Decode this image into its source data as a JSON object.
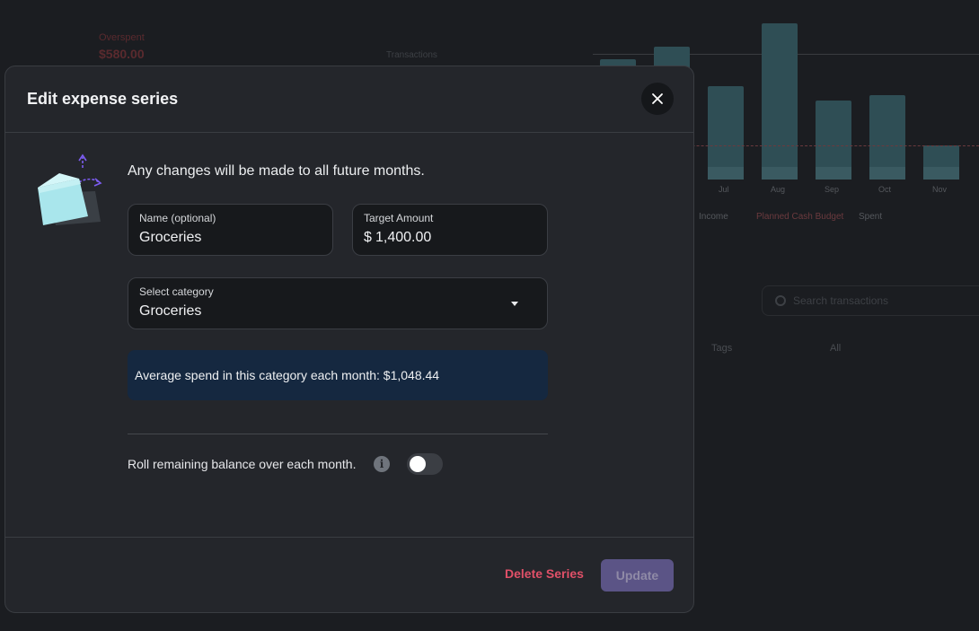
{
  "background": {
    "x_ticks": [
      "Jul",
      "Aug",
      "Sep",
      "Oct",
      "Nov"
    ],
    "legend_items": [
      "Income",
      "Planned Cash Budget",
      "Spent"
    ],
    "search_placeholder": "Search transactions",
    "column_headers": [
      "Tags",
      "All"
    ],
    "bar_levels": [
      0.67,
      0.74,
      0.52,
      0.87,
      0.44,
      0.47,
      0.19
    ],
    "red_amount_label": "Overspent",
    "red_amount_value": "$580.00",
    "mid_label": "Transactions"
  },
  "modal": {
    "title": "Edit expense series",
    "close_icon": "close-icon",
    "illustration_icon": "wallet-arrows-icon",
    "notice": "Any changes will be made to all future months.",
    "name_field": {
      "label": "Name (optional)",
      "value": "Groceries"
    },
    "amount_field": {
      "label": "Target Amount",
      "currency": "$",
      "value": "1,400.00"
    },
    "category_field": {
      "label": "Select category",
      "value": "Groceries"
    },
    "average_spend": "Average spend in this category each month: $1,048.44",
    "rollover": {
      "label": "Roll remaining balance over each month.",
      "info_icon": "info-icon",
      "enabled": false
    },
    "delete_label": "Delete Series",
    "update_label": "Update"
  },
  "colors": {
    "modal_bg": "#24262b",
    "info_box_bg": "#152840",
    "danger": "#e05068",
    "primary_disabled": "#5b5486"
  }
}
